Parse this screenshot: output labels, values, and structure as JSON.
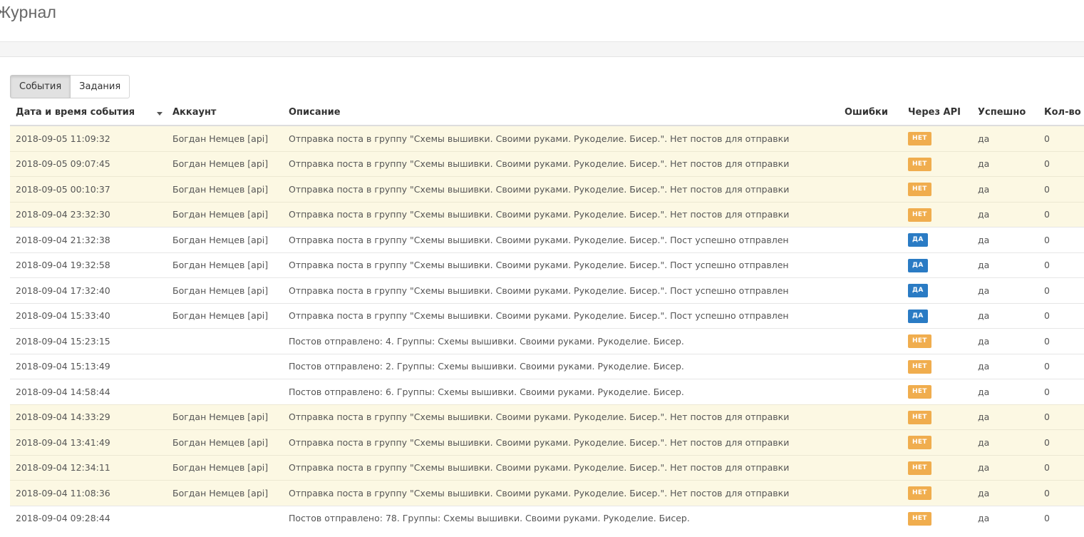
{
  "page": {
    "title": "Журнал"
  },
  "tabs": [
    {
      "label": "События",
      "active": true
    },
    {
      "label": "Задания",
      "active": false
    }
  ],
  "columns": {
    "datetime": "Дата и время события",
    "account": "Аккаунт",
    "description": "Описание",
    "errors": "Ошибки",
    "via_api": "Через API",
    "success": "Успешно",
    "count": "Кол-во п"
  },
  "colors": {
    "badge_no": "#f0ad4e",
    "badge_yes": "#2a7bc4",
    "warn_row": "#fcf8e3"
  },
  "rows": [
    {
      "datetime": "2018-09-05 11:09:32",
      "account": "Богдан Немцев [api]",
      "description": "Отправка поста в группу \"Схемы вышивки. Своими руками. Рукоделие. Бисер.\". Нет постов для отправки",
      "errors": "",
      "via_api": "НЕТ",
      "success": "да",
      "count": "0",
      "warning": true
    },
    {
      "datetime": "2018-09-05 09:07:45",
      "account": "Богдан Немцев [api]",
      "description": "Отправка поста в группу \"Схемы вышивки. Своими руками. Рукоделие. Бисер.\". Нет постов для отправки",
      "errors": "",
      "via_api": "НЕТ",
      "success": "да",
      "count": "0",
      "warning": true
    },
    {
      "datetime": "2018-09-05 00:10:37",
      "account": "Богдан Немцев [api]",
      "description": "Отправка поста в группу \"Схемы вышивки. Своими руками. Рукоделие. Бисер.\". Нет постов для отправки",
      "errors": "",
      "via_api": "НЕТ",
      "success": "да",
      "count": "0",
      "warning": true
    },
    {
      "datetime": "2018-09-04 23:32:30",
      "account": "Богдан Немцев [api]",
      "description": "Отправка поста в группу \"Схемы вышивки. Своими руками. Рукоделие. Бисер.\". Нет постов для отправки",
      "errors": "",
      "via_api": "НЕТ",
      "success": "да",
      "count": "0",
      "warning": true
    },
    {
      "datetime": "2018-09-04 21:32:38",
      "account": "Богдан Немцев [api]",
      "description": "Отправка поста в группу \"Схемы вышивки. Своими руками. Рукоделие. Бисер.\". Пост успешно отправлен",
      "errors": "",
      "via_api": "ДА",
      "success": "да",
      "count": "0",
      "warning": false
    },
    {
      "datetime": "2018-09-04 19:32:58",
      "account": "Богдан Немцев [api]",
      "description": "Отправка поста в группу \"Схемы вышивки. Своими руками. Рукоделие. Бисер.\". Пост успешно отправлен",
      "errors": "",
      "via_api": "ДА",
      "success": "да",
      "count": "0",
      "warning": false
    },
    {
      "datetime": "2018-09-04 17:32:40",
      "account": "Богдан Немцев [api]",
      "description": "Отправка поста в группу \"Схемы вышивки. Своими руками. Рукоделие. Бисер.\". Пост успешно отправлен",
      "errors": "",
      "via_api": "ДА",
      "success": "да",
      "count": "0",
      "warning": false
    },
    {
      "datetime": "2018-09-04 15:33:40",
      "account": "Богдан Немцев [api]",
      "description": "Отправка поста в группу \"Схемы вышивки. Своими руками. Рукоделие. Бисер.\". Пост успешно отправлен",
      "errors": "",
      "via_api": "ДА",
      "success": "да",
      "count": "0",
      "warning": false
    },
    {
      "datetime": "2018-09-04 15:23:15",
      "account": "",
      "description": "Постов отправлено: 4. Группы: Схемы вышивки. Своими руками. Рукоделие. Бисер.",
      "errors": "",
      "via_api": "НЕТ",
      "success": "да",
      "count": "0",
      "warning": false
    },
    {
      "datetime": "2018-09-04 15:13:49",
      "account": "",
      "description": "Постов отправлено: 2. Группы: Схемы вышивки. Своими руками. Рукоделие. Бисер.",
      "errors": "",
      "via_api": "НЕТ",
      "success": "да",
      "count": "0",
      "warning": false
    },
    {
      "datetime": "2018-09-04 14:58:44",
      "account": "",
      "description": "Постов отправлено: 6. Группы: Схемы вышивки. Своими руками. Рукоделие. Бисер.",
      "errors": "",
      "via_api": "НЕТ",
      "success": "да",
      "count": "0",
      "warning": false
    },
    {
      "datetime": "2018-09-04 14:33:29",
      "account": "Богдан Немцев [api]",
      "description": "Отправка поста в группу \"Схемы вышивки. Своими руками. Рукоделие. Бисер.\". Нет постов для отправки",
      "errors": "",
      "via_api": "НЕТ",
      "success": "да",
      "count": "0",
      "warning": true
    },
    {
      "datetime": "2018-09-04 13:41:49",
      "account": "Богдан Немцев [api]",
      "description": "Отправка поста в группу \"Схемы вышивки. Своими руками. Рукоделие. Бисер.\". Нет постов для отправки",
      "errors": "",
      "via_api": "НЕТ",
      "success": "да",
      "count": "0",
      "warning": true
    },
    {
      "datetime": "2018-09-04 12:34:11",
      "account": "Богдан Немцев [api]",
      "description": "Отправка поста в группу \"Схемы вышивки. Своими руками. Рукоделие. Бисер.\". Нет постов для отправки",
      "errors": "",
      "via_api": "НЕТ",
      "success": "да",
      "count": "0",
      "warning": true
    },
    {
      "datetime": "2018-09-04 11:08:36",
      "account": "Богдан Немцев [api]",
      "description": "Отправка поста в группу \"Схемы вышивки. Своими руками. Рукоделие. Бисер.\". Нет постов для отправки",
      "errors": "",
      "via_api": "НЕТ",
      "success": "да",
      "count": "0",
      "warning": true
    },
    {
      "datetime": "2018-09-04 09:28:44",
      "account": "",
      "description": "Постов отправлено: 78. Группы: Схемы вышивки. Своими руками. Рукоделие. Бисер.",
      "errors": "",
      "via_api": "НЕТ",
      "success": "да",
      "count": "0",
      "warning": false
    }
  ]
}
